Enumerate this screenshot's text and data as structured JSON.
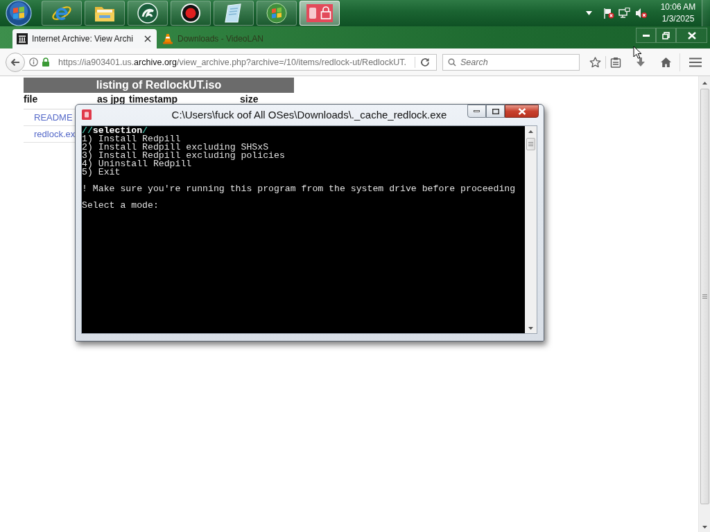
{
  "taskbar": {
    "apps": [
      {
        "kind": "ie",
        "selected": false
      },
      {
        "kind": "folder",
        "selected": false
      },
      {
        "kind": "swirl",
        "selected": false
      },
      {
        "kind": "record",
        "selected": false
      },
      {
        "kind": "notepad",
        "selected": false
      },
      {
        "kind": "windows",
        "selected": false
      },
      {
        "kind": "lock",
        "selected": true
      }
    ],
    "clock": {
      "time": "10:06 AM",
      "date": "1/3/2025"
    }
  },
  "browser": {
    "tabs": [
      {
        "kind": "archive",
        "label": "Internet Archive: View Archi",
        "selected": true
      },
      {
        "kind": "vlc",
        "label": "Downloads - VideoLAN",
        "selected": false
      }
    ],
    "address": {
      "scheme_host": "https://ia903401.us.",
      "domain": "archive.org",
      "path": "/view_archive.php?archive=/10/items/redlock-ut/RedlockUT."
    },
    "search": {
      "placeholder": "Search"
    }
  },
  "page": {
    "table": {
      "title": "listing of RedlockUT.iso",
      "columns": [
        "file",
        "as jpg",
        "timestamp",
        "size"
      ],
      "rows": [
        {
          "file": "README"
        },
        {
          "file": "redlock.ex"
        }
      ]
    }
  },
  "console_window": {
    "title": "C:\\Users\\fuck oof All OSes\\Downloads\\._cache_redlock.exe",
    "heading": [
      {
        "kind": "accent",
        "text": "//"
      },
      {
        "kind": "plain",
        "text": "selection"
      },
      {
        "kind": "accent",
        "text": "/"
      }
    ],
    "lines": [
      {
        "kind": "option",
        "text": "1) Install Redpill"
      },
      {
        "kind": "option",
        "text": "2) Install Redpill excluding SHSxS"
      },
      {
        "kind": "option",
        "text": "3) Install Redpill excluding policies"
      },
      {
        "kind": "option",
        "text": "4) Uninstall Redpill"
      },
      {
        "kind": "option",
        "text": "5) Exit"
      },
      {
        "kind": "notice",
        "text": "! Make sure you're running this program from the system drive before proceeding"
      },
      {
        "kind": "prompt",
        "text": "Select a mode:"
      }
    ]
  }
}
